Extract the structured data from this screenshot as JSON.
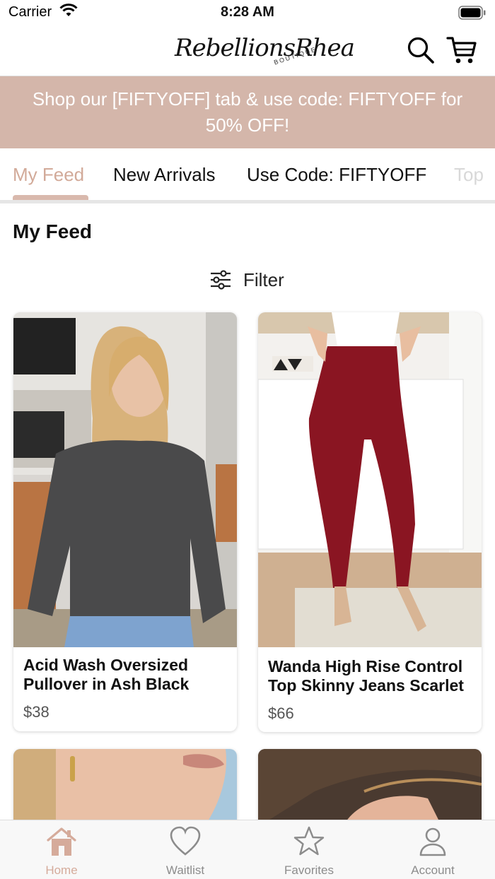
{
  "status": {
    "carrier": "Carrier",
    "time": "8:28 AM"
  },
  "header": {
    "logo_text": "RebellionsRhea",
    "logo_sub": "BOUTIQUE"
  },
  "promo": {
    "text": "Shop our [FIFTYOFF] tab & use code: FIFTYOFF for 50% OFF!"
  },
  "tabs": [
    {
      "label": "My Feed"
    },
    {
      "label": "New Arrivals"
    },
    {
      "label": "Use Code: FIFTYOFF"
    },
    {
      "label": "Top"
    }
  ],
  "feed": {
    "title": "My Feed",
    "filter_label": "Filter"
  },
  "products": [
    {
      "name": "Acid Wash Oversized Pullover in Ash Black",
      "price": "$38"
    },
    {
      "name": "Wanda High Rise Control Top Skinny Jeans Scarlet",
      "price": "$66"
    }
  ],
  "tabbar": [
    {
      "label": "Home",
      "icon": "home-icon"
    },
    {
      "label": "Waitlist",
      "icon": "heart-icon"
    },
    {
      "label": "Favorites",
      "icon": "star-icon"
    },
    {
      "label": "Account",
      "icon": "person-icon"
    }
  ],
  "colors": {
    "accent": "#d4b6aa",
    "active_tab": "#d2aa99"
  }
}
